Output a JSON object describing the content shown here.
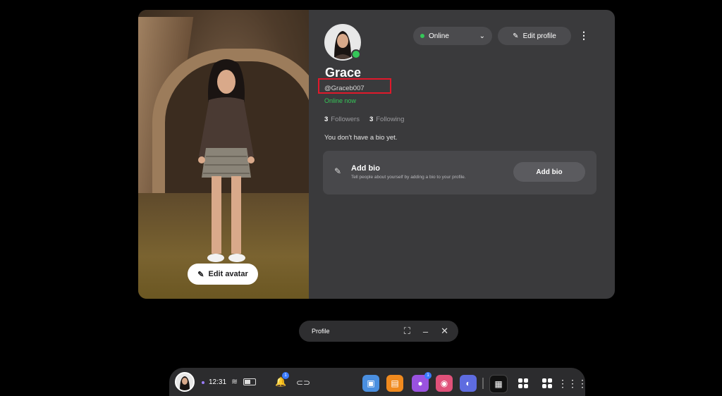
{
  "profile": {
    "display_name": "Grace",
    "username": "@Graceb007",
    "online_text": "Online now",
    "followers_count": "3",
    "followers_label": "Followers",
    "following_count": "3",
    "following_label": "Following",
    "no_bio_text": "You don't have a bio yet."
  },
  "header": {
    "status_label": "Online",
    "edit_profile_label": "Edit profile",
    "more_icon": "more-vert-icon"
  },
  "bio_card": {
    "title": "Add bio",
    "description": "Tell people about yourself by adding a bio to your profile.",
    "button_label": "Add bio"
  },
  "avatar_pane": {
    "edit_avatar_label": "Edit avatar"
  },
  "window_bar": {
    "title": "Profile"
  },
  "taskbar": {
    "time": "12:31",
    "notification_badge": "1",
    "people_badge": "1",
    "apps": [
      {
        "name": "store-app",
        "color": "#4a8fe0"
      },
      {
        "name": "shop-app",
        "color": "#f08a1e"
      },
      {
        "name": "people-app",
        "color": "#9a52e0"
      },
      {
        "name": "camera-app",
        "color": "#e0517a"
      },
      {
        "name": "browser-app",
        "color": "#5e6ce0"
      }
    ]
  },
  "colors": {
    "panel_bg": "#3a3a3c",
    "online_green": "#35c759",
    "highlight_red": "#e0192b"
  }
}
